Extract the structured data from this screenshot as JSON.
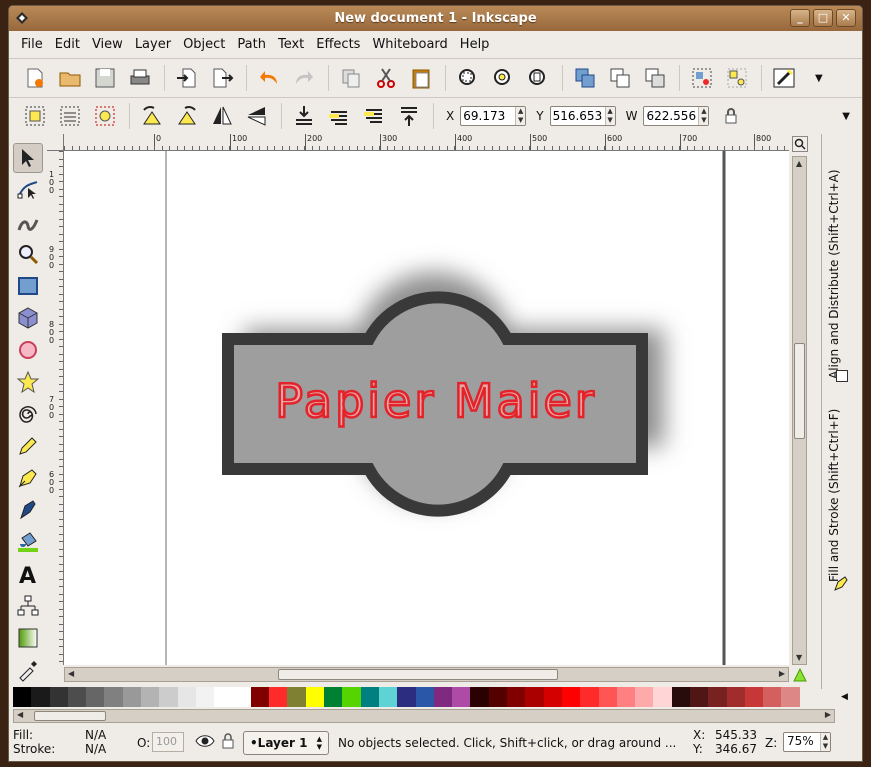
{
  "window": {
    "title": "New document 1 - Inkscape",
    "buttons": [
      "_",
      "□",
      "✕"
    ]
  },
  "menu": [
    "File",
    "Edit",
    "View",
    "Layer",
    "Object",
    "Path",
    "Text",
    "Effects",
    "Whiteboard",
    "Help"
  ],
  "toolbar_main": {
    "icons": [
      "new-document-icon",
      "open-icon",
      "save-icon",
      "print-icon",
      "import-icon",
      "export-icon",
      "undo-icon",
      "redo-icon",
      "copy-icon",
      "cut-icon",
      "paste-icon",
      "zoom-selection-icon",
      "zoom-drawing-icon",
      "zoom-page-icon",
      "duplicate-icon",
      "clone-icon",
      "unlink-clone-icon",
      "group-icon",
      "ungroup-icon",
      "xml-editor-icon"
    ]
  },
  "toolbar_select": {
    "x_label": "X",
    "x_value": "69.173",
    "y_label": "Y",
    "y_value": "516.653",
    "w_label": "W",
    "w_value": "622.556"
  },
  "left_tools": [
    "selector-tool-icon",
    "node-tool-icon",
    "tweak-tool-icon",
    "zoom-tool-icon",
    "rectangle-tool-icon",
    "box-3d-tool-icon",
    "ellipse-tool-icon",
    "star-tool-icon",
    "spiral-tool-icon",
    "pencil-tool-icon",
    "pen-tool-icon",
    "calligraphy-tool-icon",
    "paint-bucket-tool-icon",
    "text-tool-icon",
    "connector-tool-icon",
    "gradient-tool-icon",
    "dropper-tool-icon"
  ],
  "ruler": {
    "h_labels": [
      "-100",
      "0",
      "100",
      "200",
      "300",
      "400",
      "500",
      "600",
      "700",
      "800"
    ],
    "v_labels": [
      "1 0 0",
      "9 0 0",
      "8 0 0",
      "7 0 0",
      "6 0 0"
    ]
  },
  "canvas": {
    "text": "Papier Maier",
    "colors": {
      "shape_fill": "#9e9e9e",
      "shape_stroke": "#393939",
      "text_fill": "#e8a6a6",
      "text_stroke": "#e3222a"
    }
  },
  "dock": {
    "tab1": "Align and Distribute (Shift+Ctrl+A)",
    "tab2": "Fill and Stroke (Shift+Ctrl+F)"
  },
  "palette": [
    "#000000",
    "#1a1a1a",
    "#333333",
    "#4d4d4d",
    "#666666",
    "#808080",
    "#999999",
    "#b3b3b3",
    "#cccccc",
    "#e6e6e6",
    "#f2f2f2",
    "#ffffff",
    "#ffffff",
    "#800000",
    "#ff2a2a",
    "#808033",
    "#ffff00",
    "#008033",
    "#55d400",
    "#008080",
    "#5fd3d3",
    "#2c2c80",
    "#2a57a8",
    "#7f2a7f",
    "#ad4ba7",
    "#2b0000",
    "#550000",
    "#800000",
    "#aa0000",
    "#d40000",
    "#ff0000",
    "#ff2a2a",
    "#ff5555",
    "#ff8080",
    "#ffaaaa",
    "#ffd5d5",
    "#280b0b",
    "#501616",
    "#782121",
    "#a02c2c",
    "#c83737",
    "#d35f5f",
    "#de8787"
  ],
  "status": {
    "fill_label": "Fill:",
    "fill_value": "N/A",
    "stroke_label": "Stroke:",
    "stroke_value": "N/A",
    "opacity_label": "O:",
    "opacity_value": "100",
    "layer": "•Layer 1",
    "message": "No objects selected. Click, Shift+click, or drag around ...",
    "x_label": "X:",
    "x_value": "545.33",
    "y_label": "Y:",
    "y_value": "346.67",
    "zoom_label": "Z:",
    "zoom_value": "75%"
  }
}
